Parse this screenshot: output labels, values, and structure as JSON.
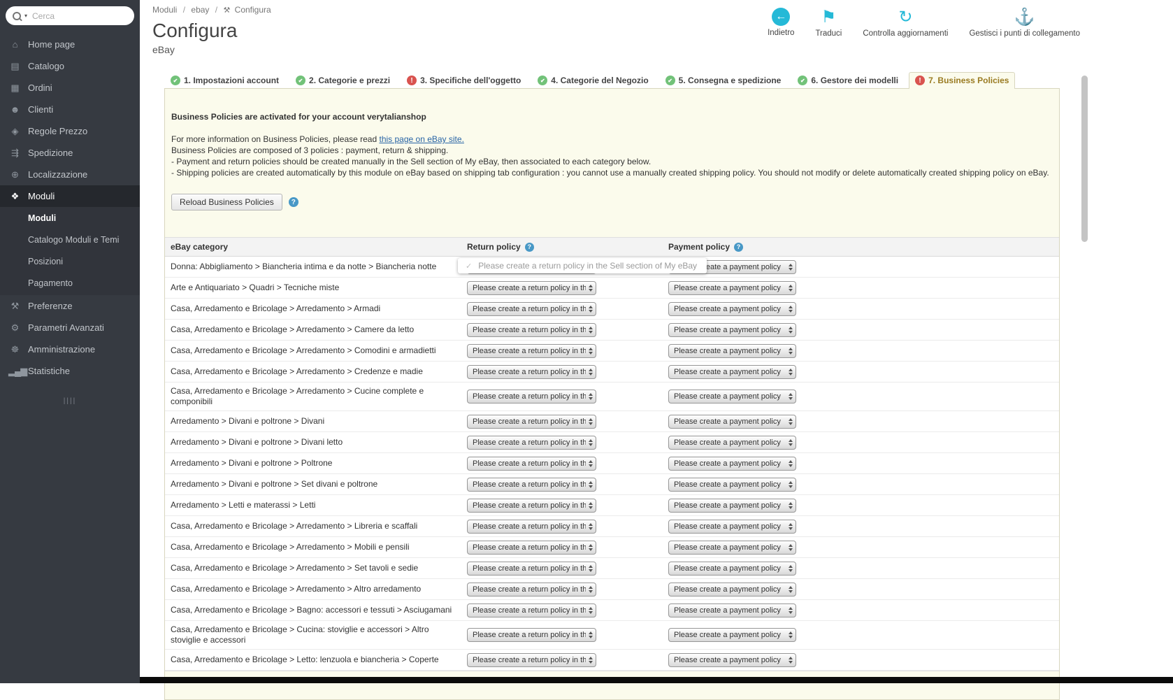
{
  "colors": {
    "accent_teal": "#25B9D7",
    "status_green": "#72C279",
    "status_red": "#D9534F",
    "help_blue": "#4898C6",
    "active_tab_text": "#9A7B22",
    "sidebar_bg": "#363A41",
    "panel_bg": "#FBFBEC"
  },
  "sidebar": {
    "search": {
      "placeholder": "Cerca"
    },
    "items": [
      {
        "id": "home",
        "label": "Home page",
        "glyph": "⌂"
      },
      {
        "id": "catalog",
        "label": "Catalogo",
        "glyph": "▤"
      },
      {
        "id": "orders",
        "label": "Ordini",
        "glyph": "▦"
      },
      {
        "id": "customers",
        "label": "Clienti",
        "glyph": "☻"
      },
      {
        "id": "price-rules",
        "label": "Regole Prezzo",
        "glyph": "◈"
      },
      {
        "id": "shipping",
        "label": "Spedizione",
        "glyph": "⇶"
      },
      {
        "id": "localization",
        "label": "Localizzazione",
        "glyph": "⊕"
      },
      {
        "id": "modules",
        "label": "Moduli",
        "glyph": "❖",
        "active": true,
        "children": [
          "Moduli",
          "Catalogo Moduli e Temi",
          "Posizioni",
          "Pagamento"
        ]
      },
      {
        "id": "preferences",
        "label": "Preferenze",
        "glyph": "⚒"
      },
      {
        "id": "advanced-parameters",
        "label": "Parametri Avanzati",
        "glyph": "⚙"
      },
      {
        "id": "administration",
        "label": "Amministrazione",
        "glyph": "☸"
      },
      {
        "id": "stats",
        "label": "Statistiche",
        "glyph": "▂▄▆"
      }
    ],
    "collapse_glyph": "||||"
  },
  "breadcrumb": {
    "part1": "Moduli",
    "part2": "ebay",
    "part3": "Configura",
    "separator": "/",
    "wrench_glyph": "⚒"
  },
  "header": {
    "title": "Configura",
    "subtitle": "eBay"
  },
  "toolbar": [
    {
      "id": "back",
      "label": "Indietro",
      "glyph": "←"
    },
    {
      "id": "translate",
      "label": "Traduci",
      "glyph": "⚑"
    },
    {
      "id": "check-updates",
      "label": "Controlla aggiornamenti",
      "glyph": "↻"
    },
    {
      "id": "manage-hooks",
      "label": "Gestisci i punti di collegamento",
      "glyph": "⚓"
    }
  ],
  "tabs": [
    {
      "label": "1. Impostazioni account",
      "status": "ok"
    },
    {
      "label": "2. Categorie e prezzi",
      "status": "ok"
    },
    {
      "label": "3. Specifiche dell'oggetto",
      "status": "error"
    },
    {
      "label": "4. Categorie del Negozio",
      "status": "ok"
    },
    {
      "label": "5. Consegna e spedizione",
      "status": "ok"
    },
    {
      "label": "6. Gestore dei modelli",
      "status": "ok"
    },
    {
      "label": "7. Business Policies",
      "status": "error",
      "active": true
    }
  ],
  "panel": {
    "heading": "Business Policies are activated for your account verytalianshop",
    "line1_prefix": "For more information on Business Policies, please read ",
    "line1_link": "this page on eBay site.",
    "line2": "Business Policies are composed of 3 policies : payment, return & shipping.",
    "line3": "- Payment and return policies should be created manually in the Sell section of My eBay, then associated to each category below.",
    "line4": "- Shipping policies are created automatically by this module on eBay based on shipping tab configuration : you cannot use a manually created shipping policy. You should not modify or delete automatically created shipping policy on eBay.",
    "reload_button": "Reload Business Policies",
    "help_glyph": "?"
  },
  "tooltip": {
    "check_glyph": "✓",
    "text": "Please create a return policy in the Sell section of My eBay"
  },
  "table": {
    "headers": [
      "eBay category",
      "Return policy",
      "Payment policy"
    ],
    "return_option": "Please create a return policy in the Sell section of My eBay",
    "payment_option": "Please create a payment policy",
    "rows": [
      "Donna: Abbigliamento > Biancheria intima e da notte > Biancheria notte",
      "Arte e Antiquariato > Quadri > Tecniche miste",
      "Casa, Arredamento e Bricolage > Arredamento > Armadi",
      "Casa, Arredamento e Bricolage > Arredamento > Camere da letto",
      "Casa, Arredamento e Bricolage > Arredamento > Comodini e armadietti",
      "Casa, Arredamento e Bricolage > Arredamento > Credenze e madie",
      "Casa, Arredamento e Bricolage > Arredamento > Cucine complete e componibili",
      "Arredamento > Divani e poltrone > Divani",
      "Arredamento > Divani e poltrone > Divani letto",
      "Arredamento > Divani e poltrone > Poltrone",
      "Arredamento > Divani e poltrone > Set divani e poltrone",
      "Arredamento > Letti e materassi > Letti",
      "Casa, Arredamento e Bricolage > Arredamento > Libreria e scaffali",
      "Casa, Arredamento e Bricolage > Arredamento > Mobili e pensili",
      "Casa, Arredamento e Bricolage > Arredamento > Set tavoli e sedie",
      "Casa, Arredamento e Bricolage > Arredamento > Altro arredamento",
      "Casa, Arredamento e Bricolage > Bagno: accessori e tessuti > Asciugamani",
      "Casa, Arredamento e Bricolage > Cucina: stoviglie e accessori > Altro stoviglie e accessori",
      "Casa, Arredamento e Bricolage > Letto: lenzuola e biancheria > Coperte"
    ]
  }
}
